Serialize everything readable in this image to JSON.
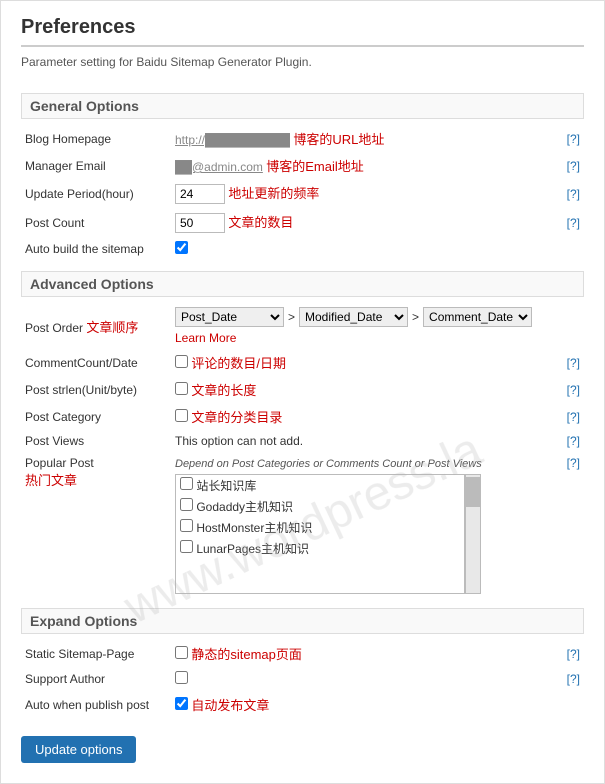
{
  "page": {
    "title": "Preferences",
    "description": "Parameter setting for Baidu Sitemap Generator Plugin.",
    "update_button": "Update options"
  },
  "general_options": {
    "section_title": "General Options",
    "fields": [
      {
        "label": "Blog Homepage",
        "value_url": "http://...",
        "hint": "博客的URL地址",
        "help": "[?]"
      },
      {
        "label": "Manager Email",
        "value_url": "**@admin.com",
        "hint": "博客的Email地址",
        "help": "[?]"
      },
      {
        "label": "Update Period(hour)",
        "value": "24",
        "hint": "地址更新的频率",
        "help": "[?]"
      },
      {
        "label": "Post Count",
        "value": "50",
        "hint": "文章的数目",
        "help": "[?]"
      },
      {
        "label": "Auto build the sitemap",
        "checked": true,
        "hint": "",
        "help": ""
      }
    ]
  },
  "advanced_options": {
    "section_title": "Advanced Options",
    "post_order": {
      "label": "Post Order",
      "label_red": "文章顺序",
      "select1": "Post_Date",
      "select2": "Modified_Date",
      "select3": "Comment_Date",
      "arrow": ">",
      "learn_more": "Learn More",
      "help": ""
    },
    "fields": [
      {
        "label": "CommentCount/Date",
        "hint": "评论的数目/日期",
        "checked": false,
        "help": "[?]"
      },
      {
        "label": "Post strlen(Unit/byte)",
        "hint": "文章的长度",
        "checked": false,
        "help": "[?]"
      },
      {
        "label": "Post Category",
        "hint": "文章的分类目录",
        "checked": false,
        "help": "[?]"
      },
      {
        "label": "Post Views",
        "hint": "",
        "help": "[?]"
      }
    ],
    "post_views_note": "This option can not add.",
    "popular_post": {
      "label": "Popular Post",
      "label_red": "热门文章",
      "note": "Depend on Post Categories or Comments Count or Post Views",
      "items": [
        "站长知识库",
        "Godaddy主机知识",
        "HostMonster主机知识",
        "LunarPages主机知识"
      ],
      "help": "[?]"
    }
  },
  "expand_options": {
    "section_title": "Expand Options",
    "fields": [
      {
        "label": "Static Sitemap-Page",
        "hint": "静态的sitemap页面",
        "checked": false,
        "help": "[?]"
      },
      {
        "label": "Support Author",
        "hint": "",
        "checked": false,
        "help": "[?]"
      },
      {
        "label": "Auto when publish post",
        "hint": "自动发布文章",
        "checked": true,
        "help": ""
      }
    ]
  },
  "icons": {
    "checkbox_checked": "✔",
    "help": "?",
    "arrow": ">"
  }
}
